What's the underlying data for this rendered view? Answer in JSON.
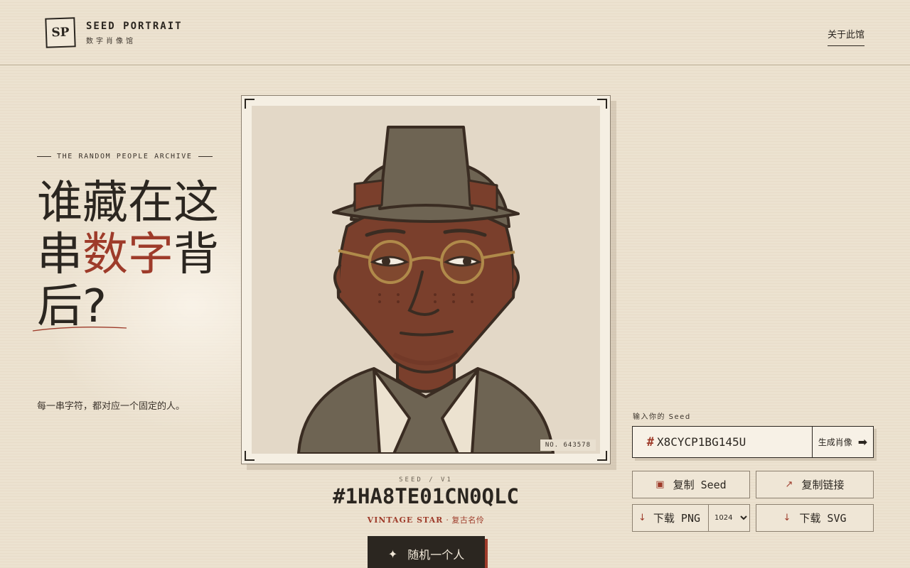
{
  "header": {
    "logo_mark": "SP",
    "logo_title": "SEED PORTRAIT",
    "logo_subtitle": "数字肖像馆",
    "about_link": "关于此馆"
  },
  "hero": {
    "eyebrow": "THE RANDOM PEOPLE ARCHIVE",
    "headline_part1": "谁藏在这串",
    "headline_accent": "数字",
    "headline_part2": "背后?",
    "tagline": "每一串字符，都对应一个固定的人。"
  },
  "portrait": {
    "serial": "NO. 643578",
    "seed_label": "SEED / V1",
    "seed_value": "#1HA8TE01CN0QLC",
    "style_en": "VINTAGE STAR",
    "style_sep": " · ",
    "style_zh": "复古名伶",
    "random_button": "随机一个人",
    "random_icon": "sparkle-icon"
  },
  "controls": {
    "input_label": "输入你的 Seed",
    "hash_symbol": "#",
    "seed_input_value": "X8CYCP1BG145U",
    "generate_button": "生成肖像",
    "generate_arrow": "➡",
    "copy_seed": "复制 Seed",
    "copy_link": "复制链接",
    "download_png": "下载 PNG",
    "download_svg": "下载 SVG",
    "png_size_selected": "1024",
    "png_size_options": [
      "1024"
    ]
  },
  "colors": {
    "background": "#ece2d0",
    "ink": "#2b2620",
    "accent": "#9e3b2a",
    "skin": "#7a3f2c",
    "hat": "#6e6453",
    "portrait_bg": "#e3d8c7"
  }
}
